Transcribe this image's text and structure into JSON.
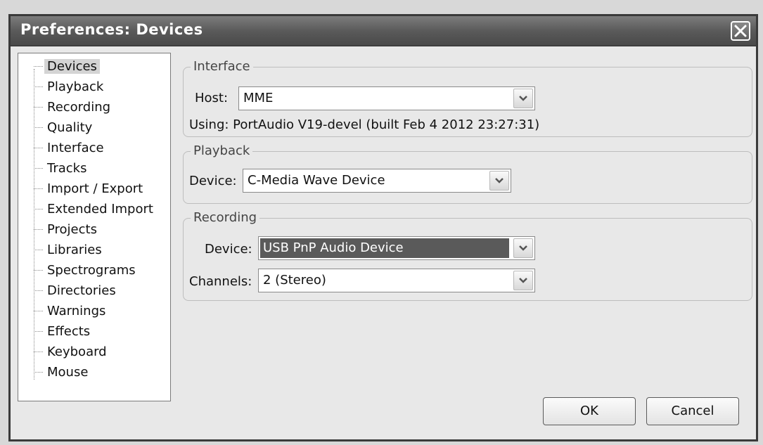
{
  "window": {
    "title": "Preferences: Devices"
  },
  "tree": {
    "items": [
      {
        "label": "Devices",
        "selected": true
      },
      {
        "label": "Playback"
      },
      {
        "label": "Recording"
      },
      {
        "label": "Quality"
      },
      {
        "label": "Interface"
      },
      {
        "label": "Tracks"
      },
      {
        "label": "Import / Export"
      },
      {
        "label": "Extended Import"
      },
      {
        "label": "Projects"
      },
      {
        "label": "Libraries"
      },
      {
        "label": "Spectrograms"
      },
      {
        "label": "Directories"
      },
      {
        "label": "Warnings"
      },
      {
        "label": "Effects"
      },
      {
        "label": "Keyboard"
      },
      {
        "label": "Mouse"
      }
    ]
  },
  "interface": {
    "legend": "Interface",
    "host_label": "Host:",
    "host_value": "MME",
    "using_text": "Using: PortAudio V19-devel (built Feb  4 2012 23:27:31)"
  },
  "playback": {
    "legend": "Playback",
    "device_label": "Device:",
    "device_value": "C-Media Wave Device"
  },
  "recording": {
    "legend": "Recording",
    "device_label": "Device:",
    "device_value": "USB PnP Audio Device",
    "channels_label": "Channels:",
    "channels_value": "2 (Stereo)"
  },
  "buttons": {
    "ok": "OK",
    "cancel": "Cancel"
  },
  "icons": {
    "close": "close-icon",
    "dropdown": "chevron-down-icon"
  },
  "colors": {
    "titlebar": "#5a5a5a",
    "selection": "#5a5a5a",
    "background": "#e8e8e8"
  }
}
